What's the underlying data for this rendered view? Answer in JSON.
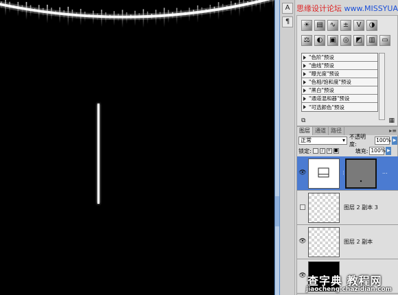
{
  "watermark_top": {
    "prefix": "思缘设计论坛 ",
    "site": "www.MISSYUAN.COM"
  },
  "icon_strip": {
    "btn1": "A",
    "btn2": "¶"
  },
  "adjustments": {
    "presets": [
      "\"色阶\"预设",
      "\"曲线\"预设",
      "\"曝光度\"预设",
      "\"色相/饱和度\"预设",
      "\"黑白\"预设",
      "\"通道混和器\"预设",
      "\"可选颜色\"预设"
    ]
  },
  "layers_panel": {
    "tabs": [
      "图层",
      "通道",
      "路径"
    ],
    "blend_mode": "正常",
    "opacity_label": "不透明度:",
    "opacity_value": "100%",
    "lock_label": "锁定:",
    "fill_label": "填充:",
    "fill_value": "100%",
    "layers": [
      {
        "name": "",
        "selected": true,
        "visible": true
      },
      {
        "name": "图层 2 副本 3",
        "selected": false,
        "visible": false
      },
      {
        "name": "图层 2 副本",
        "selected": false,
        "visible": true
      },
      {
        "name": "",
        "selected": false,
        "visible": true
      }
    ]
  },
  "watermark_bottom": {
    "line1": "查字典 教程网",
    "line2": "jiaocheng.chazidian.com"
  },
  "colors": {
    "selection": "#4b7bd1",
    "canvas": "#000000",
    "scroll_accent": "#5a8ac6"
  }
}
